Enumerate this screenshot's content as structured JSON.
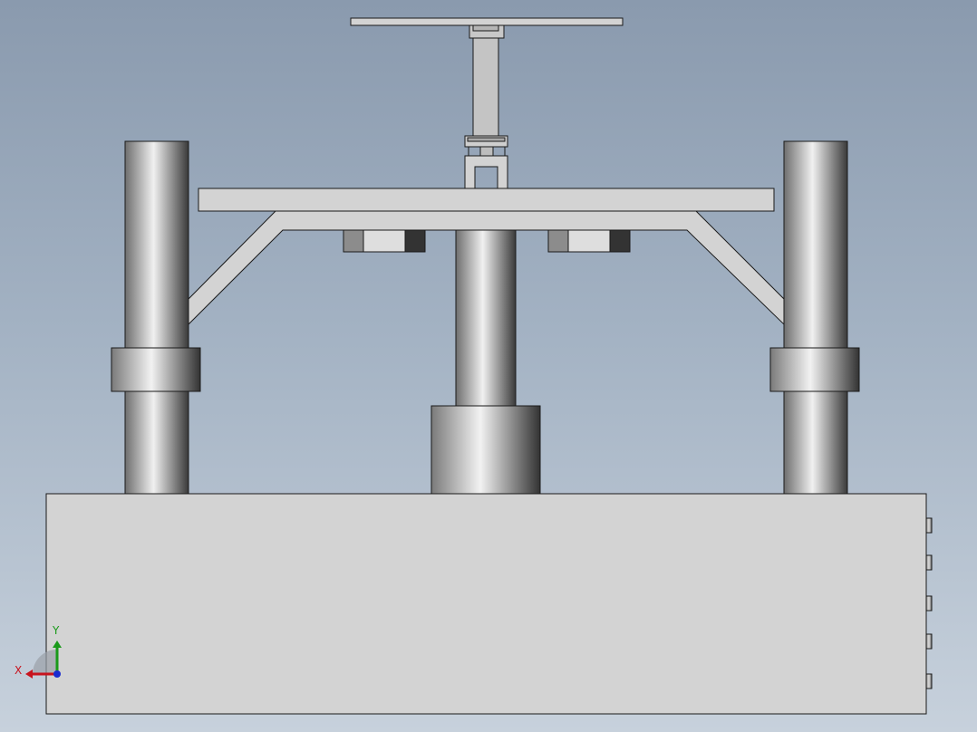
{
  "view": {
    "background_top": "#8a9aae",
    "background_bottom": "#c7d1dc",
    "part_color": "#d3d3d3",
    "edge_color": "#1a1a1a"
  },
  "triad": {
    "x_label": "X",
    "y_label": "Y",
    "x_color": "#c8141e",
    "y_color": "#1a9a1a",
    "z_color": "#1a2ad0"
  }
}
